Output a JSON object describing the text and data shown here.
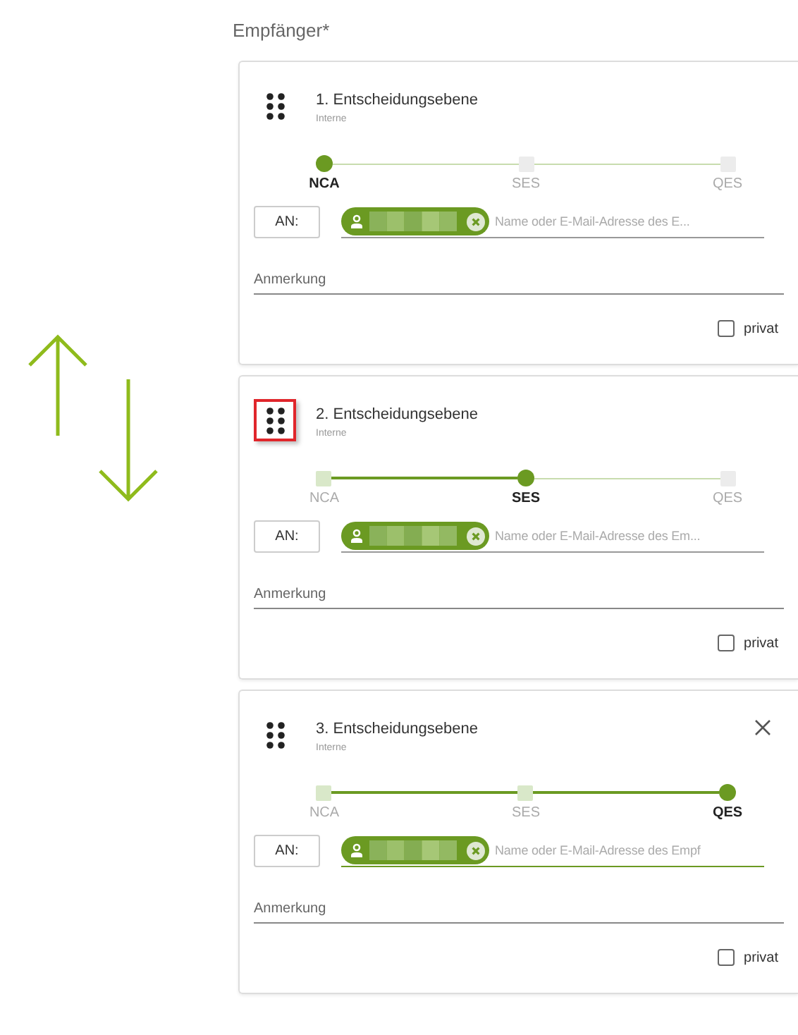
{
  "section_label": "Empfänger*",
  "levels": [
    {
      "title": "1. Entscheidungsebene",
      "subtitle": "Interne",
      "handle_highlighted": false,
      "closable": false,
      "steps": [
        {
          "label": "NCA",
          "current": true
        },
        {
          "label": "SES",
          "current": false
        },
        {
          "label": "QES",
          "current": false
        }
      ],
      "to_button": "AN:",
      "recipient": {
        "kind": "redacted"
      },
      "placeholder": "Name oder E-Mail-Adresse des E...",
      "focused": false,
      "note_placeholder": "Anmerkung",
      "private": {
        "label": "privat",
        "checked": false
      }
    },
    {
      "title": "2. Entscheidungsebene",
      "subtitle": "Interne",
      "handle_highlighted": true,
      "closable": false,
      "steps": [
        {
          "label": "NCA",
          "current": false
        },
        {
          "label": "SES",
          "current": true
        },
        {
          "label": "QES",
          "current": false
        }
      ],
      "to_button": "AN:",
      "recipient": {
        "kind": "redacted"
      },
      "placeholder": "Name oder E-Mail-Adresse des Em...",
      "focused": false,
      "note_placeholder": "Anmerkung",
      "private": {
        "label": "privat",
        "checked": false
      }
    },
    {
      "title": "3. Entscheidungsebene",
      "subtitle": "Interne",
      "handle_highlighted": false,
      "closable": true,
      "steps": [
        {
          "label": "NCA",
          "current": false
        },
        {
          "label": "SES",
          "current": false
        },
        {
          "label": "QES",
          "current": true
        }
      ],
      "to_button": "AN:",
      "recipient": {
        "kind": "redacted"
      },
      "placeholder": "Name oder E-Mail-Adresse des Empf",
      "focused": true,
      "note_placeholder": "Anmerkung",
      "private": {
        "label": "privat",
        "checked": false
      }
    }
  ]
}
